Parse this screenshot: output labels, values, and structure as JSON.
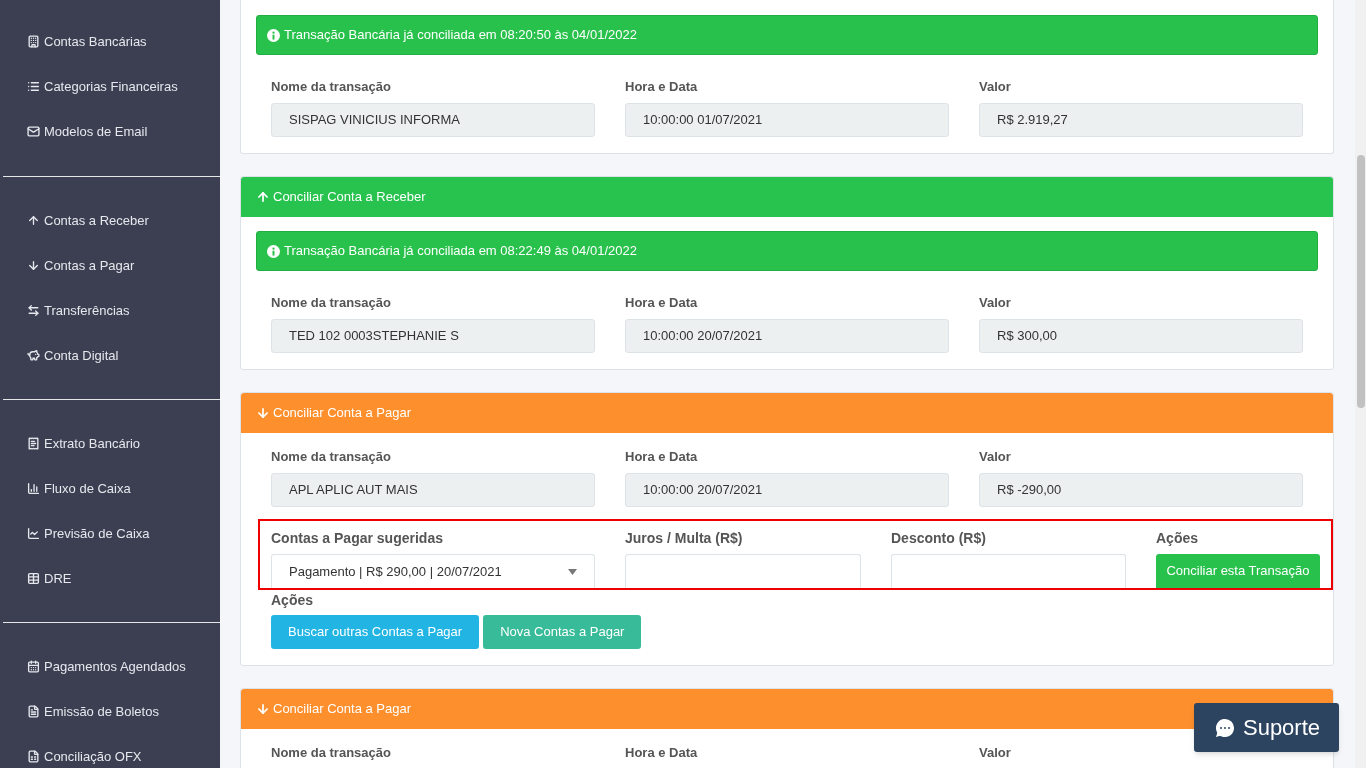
{
  "sidebar": {
    "groups": [
      {
        "items": [
          {
            "label": "Contas Bancárias"
          },
          {
            "label": "Categorias Financeiras"
          },
          {
            "label": "Modelos de Email"
          }
        ]
      },
      {
        "items": [
          {
            "label": "Contas a Receber"
          },
          {
            "label": "Contas a Pagar"
          },
          {
            "label": "Transferências"
          },
          {
            "label": "Conta Digital"
          }
        ]
      },
      {
        "items": [
          {
            "label": "Extrato Bancário"
          },
          {
            "label": "Fluxo de Caixa"
          },
          {
            "label": "Previsão de Caixa"
          },
          {
            "label": "DRE"
          }
        ]
      },
      {
        "items": [
          {
            "label": "Pagamentos Agendados"
          },
          {
            "label": "Emissão de Boletos"
          },
          {
            "label": "Conciliação OFX"
          }
        ]
      }
    ]
  },
  "cards": [
    {
      "kind": "plain",
      "alert": "Transação Bancária já conciliada em 08:20:50 às 04/01/2022",
      "fields": [
        {
          "label": "Nome da transação",
          "value": "SISPAG  VINICIUS INFORMA"
        },
        {
          "label": "Hora e Data",
          "value": "10:00:00 01/07/2021"
        },
        {
          "label": "Valor",
          "value": "R$ 2.919,27"
        }
      ]
    },
    {
      "kind": "receivable",
      "header": "Conciliar Conta a Receber",
      "alert": "Transação Bancária já conciliada em 08:22:49 às 04/01/2022",
      "fields": [
        {
          "label": "Nome da transação",
          "value": "TED 102 0003STEPHANIE S"
        },
        {
          "label": "Hora e Data",
          "value": "10:00:00 20/07/2021"
        },
        {
          "label": "Valor",
          "value": "R$ 300,00"
        }
      ]
    },
    {
      "kind": "payable",
      "header": "Conciliar Conta a Pagar",
      "fields": [
        {
          "label": "Nome da transação",
          "value": "APL APLIC AUT MAIS"
        },
        {
          "label": "Hora e Data",
          "value": "10:00:00 20/07/2021"
        },
        {
          "label": "Valor",
          "value": "R$ -290,00"
        }
      ],
      "suggestion": {
        "highlighted": true,
        "select_label": "Contas a Pagar sugeridas",
        "select_value": "Pagamento | R$ 290,00 | 20/07/2021",
        "interest_label": "Juros / Multa (R$)",
        "discount_label": "Desconto (R$)",
        "actions_label": "Ações",
        "button": "Conciliar esta Transação"
      },
      "actions": {
        "label": "Ações",
        "buttons": [
          "Buscar outras Contas a Pagar",
          "Nova Contas a Pagar"
        ]
      }
    },
    {
      "kind": "payable",
      "header": "Conciliar Conta a Pagar",
      "fields": [
        {
          "label": "Nome da transação"
        },
        {
          "label": "Hora e Data"
        },
        {
          "label": "Valor"
        }
      ]
    }
  ],
  "support_button": "Suporte"
}
